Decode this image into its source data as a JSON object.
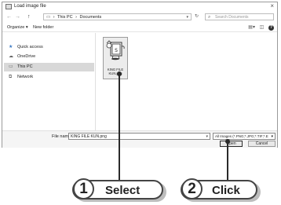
{
  "window": {
    "title": "Load image file",
    "close": "×"
  },
  "nav": {
    "back": "←",
    "forward": "→",
    "up": "↑",
    "path_root": "This PC",
    "path_sep": "›",
    "path_current": "Documents",
    "refresh": "↻",
    "search_placeholder": "Search Documents"
  },
  "toolbar": {
    "organize": "Organize ▾",
    "new_folder": "New folder"
  },
  "sidebar": {
    "items": [
      {
        "label": "Quick access",
        "icon": "star-icon"
      },
      {
        "label": "OneDrive",
        "icon": "cloud-icon"
      },
      {
        "label": "This PC",
        "icon": "computer-icon"
      },
      {
        "label": "Network",
        "icon": "network-icon"
      }
    ],
    "selected": "This PC"
  },
  "files": [
    {
      "name": "KING FILE KUN.png",
      "selected": true
    }
  ],
  "bottom": {
    "file_name_label": "File name:",
    "file_name_value": "KING FILE KUN.png",
    "file_type": "All Images (*.PNG;*.JPG;*.TIF;*.E",
    "open": "Open",
    "cancel": "Cancel"
  },
  "callouts": [
    {
      "number": "1",
      "label": "Select"
    },
    {
      "number": "2",
      "label": "Click"
    }
  ]
}
